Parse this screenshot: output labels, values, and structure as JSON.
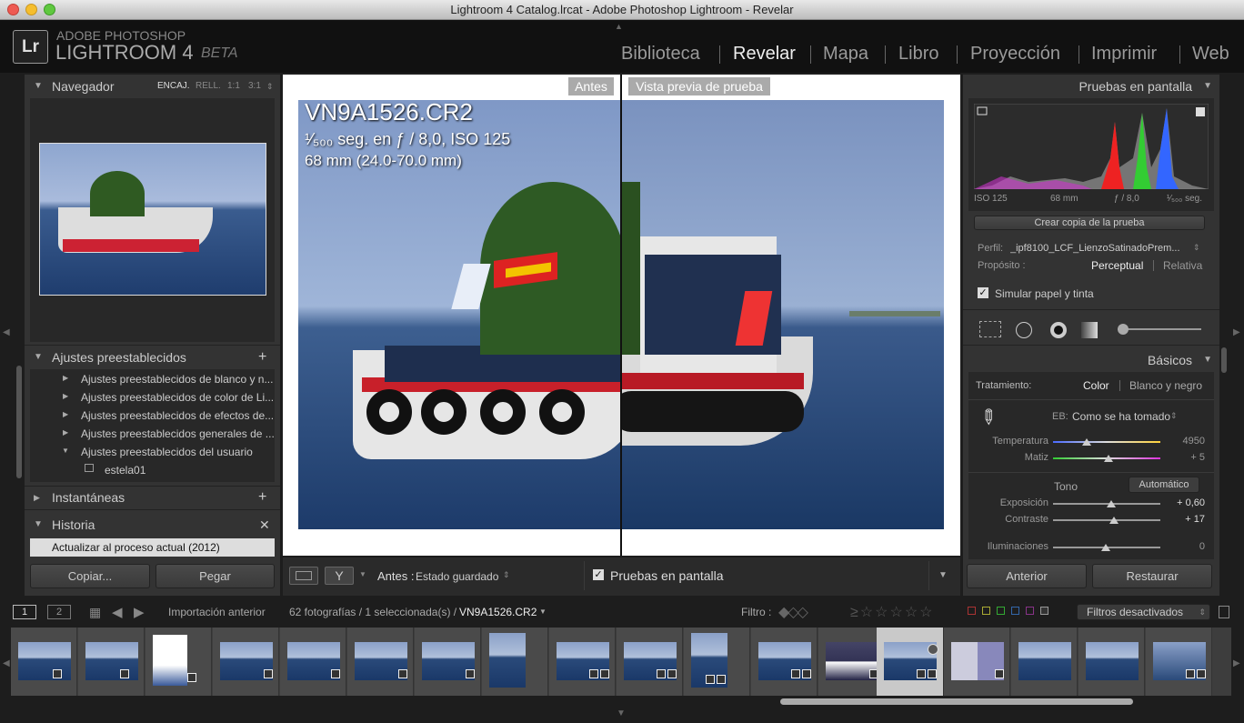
{
  "window": {
    "title": "Lightroom 4 Catalog.lrcat - Adobe Photoshop Lightroom - Revelar"
  },
  "brand": {
    "logo": "Lr",
    "line1": "ADOBE PHOTOSHOP",
    "product": "LIGHTROOM 4",
    "beta": "BETA"
  },
  "modules": [
    {
      "label": "Biblioteca",
      "active": false
    },
    {
      "label": "Revelar",
      "active": true
    },
    {
      "label": "Mapa",
      "active": false
    },
    {
      "label": "Libro",
      "active": false
    },
    {
      "label": "Proyección",
      "active": false
    },
    {
      "label": "Imprimir",
      "active": false
    },
    {
      "label": "Web",
      "active": false
    }
  ],
  "left": {
    "navigator": {
      "title": "Navegador",
      "zoom": [
        "ENCAJ.",
        "RELL.",
        "1:1",
        "3:1"
      ]
    },
    "presets": {
      "title": "Ajustes preestablecidos",
      "items": [
        "Ajustes preestablecidos de blanco y n...",
        "Ajustes preestablecidos de color de Li...",
        "Ajustes preestablecidos de efectos de...",
        "Ajustes preestablecidos generales de ...",
        "Ajustes preestablecidos del usuario"
      ],
      "sub_item": "estela01"
    },
    "snapshots": {
      "title": "Instantáneas"
    },
    "history": {
      "title": "Historia",
      "item": "Actualizar al proceso actual (2012)"
    },
    "copy_button": "Copiar...",
    "paste_button": "Pegar"
  },
  "center": {
    "before_label": "Antes",
    "proof_label": "Vista previa de prueba",
    "filename": "VN9A1526.CR2",
    "exposure_line": "¹⁄₅₀₀ seg. en ƒ / 8,0, ISO 125",
    "lens_line": "68 mm (24.0-70.0 mm)"
  },
  "toolbar": {
    "before_label": "Antes :",
    "state": "Estado guardado",
    "softproof_label": "Pruebas en pantalla"
  },
  "right": {
    "softproof_title": "Pruebas en pantalla",
    "histo_info": [
      "ISO 125",
      "68 mm",
      "ƒ / 8,0",
      "¹⁄₅₀₀ seg."
    ],
    "create_copy": "Crear copia de la prueba",
    "profile_label": "Perfil:",
    "profile_value": "_ipf8100_LCF_LienzoSatinadoPrem...",
    "intent_label": "Propósito :",
    "intent_options": [
      "Perceptual",
      "Relativa"
    ],
    "simulate": "Simular papel y tinta",
    "basic_title": "Básicos",
    "treatment_label": "Tratamiento:",
    "treatment_color": "Color",
    "treatment_bw": "Blanco y negro",
    "wb_label": "EB:",
    "wb_value": "Como se ha tomado",
    "temp_label": "Temperatura",
    "temp_value": "4950",
    "tint_label": "Matiz",
    "tint_value": "+ 5",
    "tone_label": "Tono",
    "auto_label": "Automático",
    "exposure_label": "Exposición",
    "exposure_value": "+ 0,60",
    "contrast_label": "Contraste",
    "contrast_value": "+ 17",
    "highlights_label": "Iluminaciones",
    "highlights_value": "0",
    "prev_button": "Anterior",
    "reset_button": "Restaurar"
  },
  "filmstrip": {
    "page1": "1",
    "page2": "2",
    "source": "Importación anterior",
    "count": "62 fotografías / 1 seleccionada(s) /",
    "current": "VN9A1526.CR2",
    "filter_label": "Filtro :",
    "filter_value": "Filtros desactivados"
  },
  "colors": {
    "accent": "#ffffff",
    "panel": "#333333",
    "background": "#1d1d1d"
  }
}
